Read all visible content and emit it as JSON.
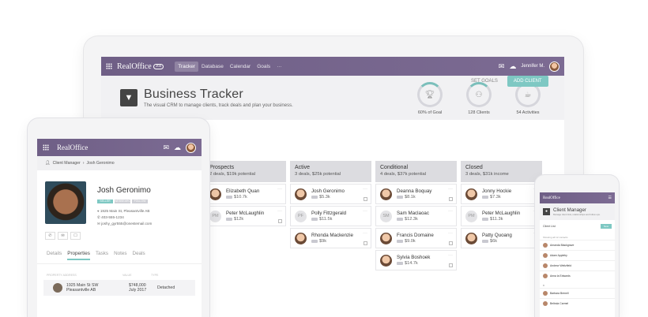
{
  "desktop": {
    "brand": "RealOffice",
    "brand_badge": "360",
    "nav": [
      "Tracker",
      "Database",
      "Calendar",
      "Goals",
      "···"
    ],
    "user": "Jennifer M.",
    "title": "Business Tracker",
    "subtitle": "The visual CRM to manage clients, track deals and plan your business.",
    "stats": [
      {
        "label": "60% of Goal",
        "icon": "trophy-icon"
      },
      {
        "label": "128 Clients",
        "icon": "people-icon"
      },
      {
        "label": "54 Activities",
        "icon": "cup-icon"
      }
    ],
    "set_goals": "SET GOALS",
    "add_client": "ADD CLIENT",
    "columns": [
      {
        "name": "Prospects",
        "summary": "2 deals, $19k potential",
        "cards": [
          {
            "name": "Elizabeth Quan",
            "value": "$10.7k"
          },
          {
            "name": "Peter McLaughlin",
            "value": "$12k",
            "initials": "PM"
          }
        ]
      },
      {
        "name": "Active",
        "summary": "3 deals, $25k potential",
        "cards": [
          {
            "name": "Josh Geronimo",
            "value": "$5.3k"
          },
          {
            "name": "Polly Fittzgerald",
            "value": "$11.5k",
            "initials": "PF"
          },
          {
            "name": "Rhonda Mackenzie",
            "value": "$9k"
          }
        ]
      },
      {
        "name": "Conditional",
        "summary": "4 deals, $37k potential",
        "cards": [
          {
            "name": "Deanna Boquay",
            "value": "$8.1k"
          },
          {
            "name": "Sam Maclaoac",
            "value": "$12.3k",
            "initials": "SM"
          },
          {
            "name": "Francis Domaine",
            "value": "$9.0k"
          },
          {
            "name": "Sylvia Boshoek",
            "value": "$14.7k"
          }
        ]
      },
      {
        "name": "Closed",
        "summary": "3 deals, $31k income",
        "cards": [
          {
            "name": "Jonny Hockie",
            "value": "$7.3k"
          },
          {
            "name": "Peter McLaughlin",
            "value": "$11.3k",
            "initials": "PM"
          },
          {
            "name": "Patty Quoang",
            "value": "$6k"
          }
        ]
      }
    ]
  },
  "tablet": {
    "brand": "RealOffice",
    "breadcrumb": [
      "Client Manager",
      "Josh Geronimo"
    ],
    "name": "Josh Geronimo",
    "tags": [
      "SELLER",
      "WEBSEARCH",
      "FOLLOW UP"
    ],
    "info": [
      "1925 Main St, Pleasantville AB",
      "403-555-1234",
      "joshy_gyr555@onestemail.com"
    ],
    "tabs": [
      "Details",
      "Properties",
      "Tasks",
      "Notes",
      "Deals"
    ],
    "table_head": [
      "Property Address",
      "Value",
      "Type"
    ],
    "row": {
      "address": "1925 Main St SW",
      "city": "Pleasantville AB",
      "value": "$748,000",
      "date": "July 2017",
      "type": "Detached"
    }
  },
  "phone": {
    "brand": "RealOffice",
    "title": "Client Manager",
    "subtitle": "Manage client lists, relationships and follow ups.",
    "list_label": "Client List",
    "new_label": "New",
    "section": "Showing all 12 contacts",
    "clients": [
      "Amanda Blackgrave",
      "Adam Appleby",
      "Andrew Weitzfield",
      "Anna la Edwards"
    ],
    "section2": "B",
    "clients2": [
      "Barbara Brenell",
      "Belinda Carmel"
    ]
  }
}
